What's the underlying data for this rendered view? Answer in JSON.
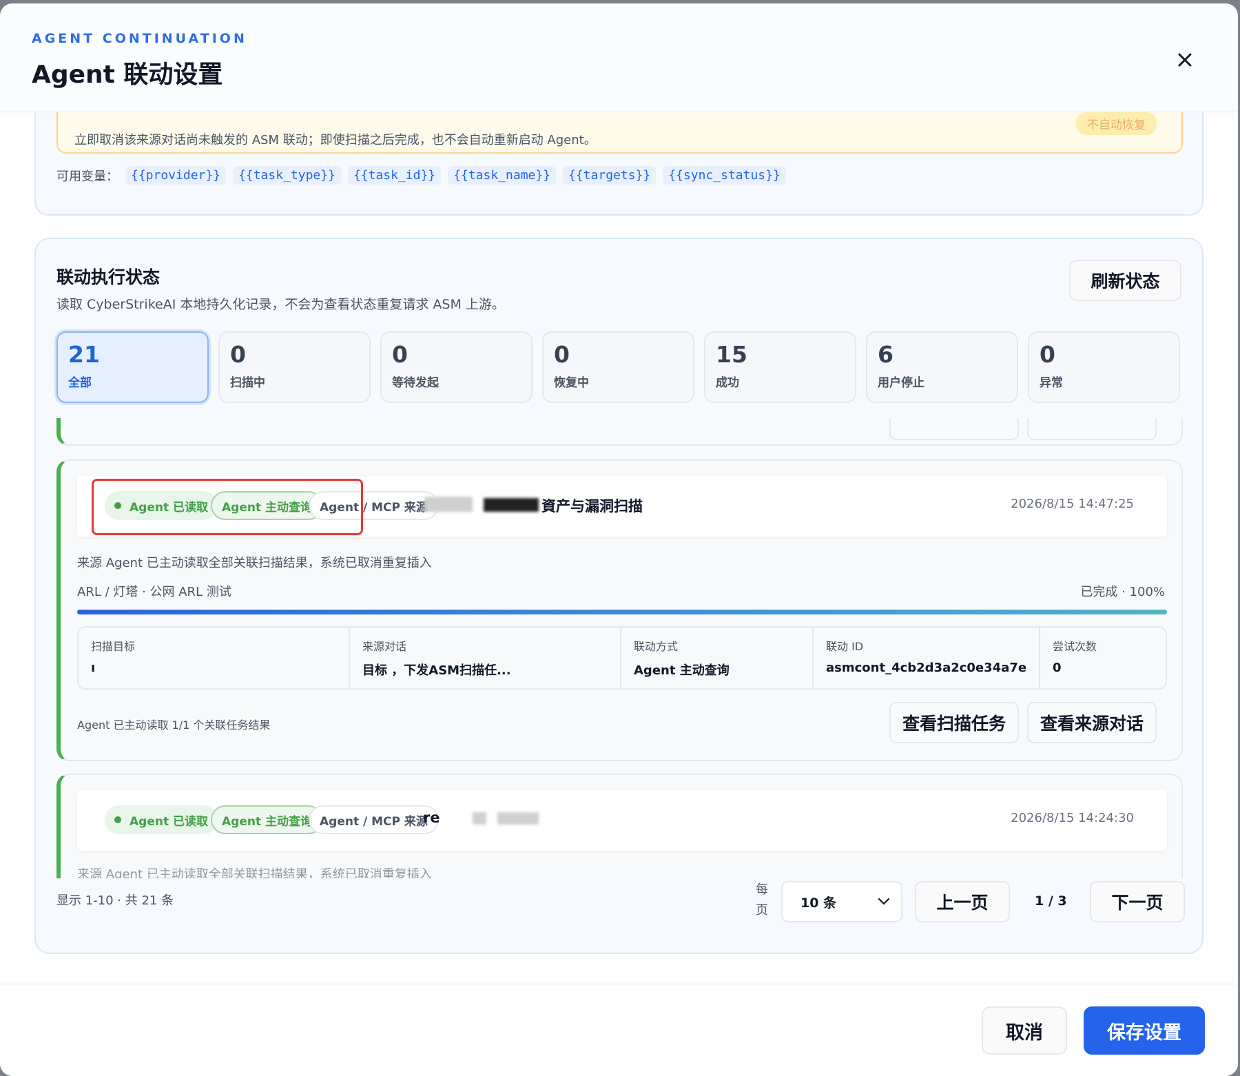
{
  "header": {
    "eyebrow": "AGENT CONTINUATION",
    "title": "Agent 联动设置",
    "close_icon": "close-icon"
  },
  "notice": {
    "text": "立即取消该来源对话尚未触发的 ASM 联动；即使扫描之后完成，也不会自动重新启动 Agent。",
    "badge": "不自动恢复"
  },
  "variables": {
    "label": "可用变量：",
    "items": [
      "{{provider}}",
      "{{task_type}}",
      "{{task_id}}",
      "{{task_name}}",
      "{{targets}}",
      "{{sync_status}}"
    ]
  },
  "status_section": {
    "title": "联动执行状态",
    "subtitle": "读取 CyberStrikeAI 本地持久化记录，不会为查看状态重复请求 ASM 上游。",
    "refresh_label": "刷新状态",
    "stats": [
      {
        "num": "21",
        "label": "全部"
      },
      {
        "num": "0",
        "label": "扫描中"
      },
      {
        "num": "0",
        "label": "等待发起"
      },
      {
        "num": "0",
        "label": "恢复中"
      },
      {
        "num": "15",
        "label": "成功"
      },
      {
        "num": "6",
        "label": "用户停止"
      },
      {
        "num": "0",
        "label": "异常"
      }
    ]
  },
  "records": [
    {
      "badge_read": "Agent 已读取",
      "badge_mode": "Agent 主动查询",
      "badge_source": "Agent / MCP 来源",
      "title_visible": "資产与漏洞扫描",
      "time": "2026/8/15 14:47:25",
      "message": "来源 Agent 已主动读取全部关联扫描结果，系统已取消重复插入",
      "source": "ARL / 灯塔 · 公网 ARL 测试",
      "progress_text": "已完成 · 100%",
      "progress": 1.0,
      "details": [
        {
          "label": "扫描目标",
          "value": "ı"
        },
        {
          "label": "来源对话",
          "value": "目标                ，下发ASM扫描任..."
        },
        {
          "label": "联动方式",
          "value": "Agent 主动查询"
        },
        {
          "label": "联动 ID",
          "value": "asmcont_4cb2d3a2c0e34a7e..."
        },
        {
          "label": "尝试次数",
          "value": "0"
        }
      ],
      "footer_text": "Agent 已主动读取 1/1 个关联任务结果",
      "view_task_label": "查看扫描任务",
      "view_chat_label": "查看来源对话"
    },
    {
      "badge_read": "Agent 已读取",
      "badge_mode": "Agent 主动查询",
      "badge_source": "Agent / MCP 来源",
      "title_visible": "re",
      "time": "2026/8/15 14:24:30",
      "message": "来源 Agent 已主动读取全部关联扫描结果，系统已取消重复插入"
    }
  ],
  "pagination": {
    "info": "显示 1-10 · 共 21 条",
    "per_page_label": "每页",
    "per_page_value": "10 条",
    "prev_label": "上一页",
    "indicator": "1 / 3",
    "next_label": "下一页"
  },
  "footer": {
    "cancel_label": "取消",
    "save_label": "保存设置"
  },
  "colors": {
    "accent": "#2563eb",
    "success": "#43a047",
    "highlight": "#e53935"
  }
}
